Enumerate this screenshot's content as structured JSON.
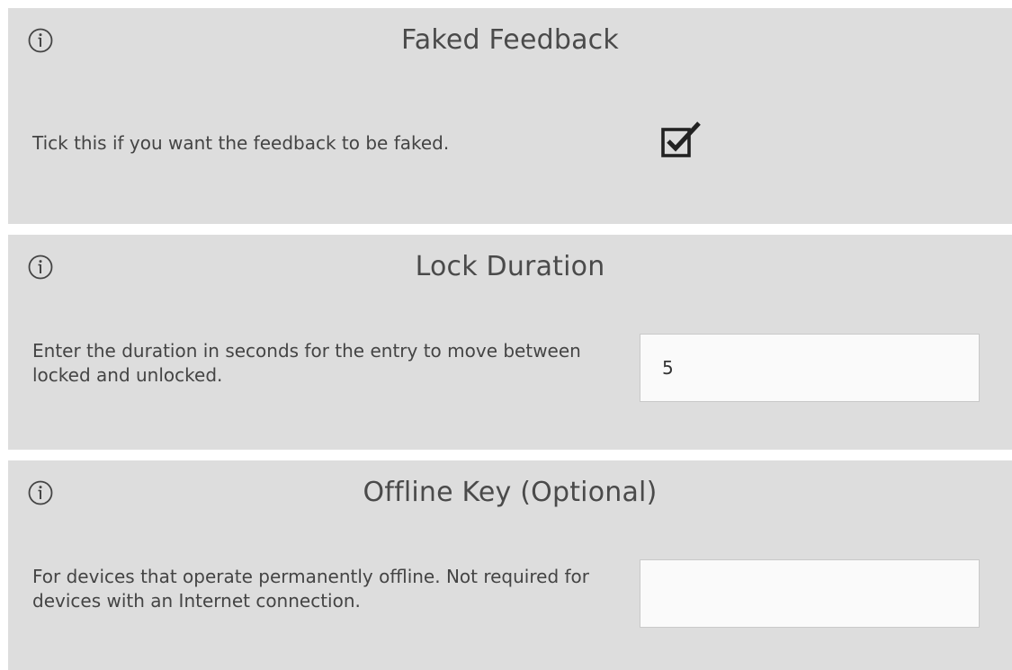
{
  "settings": [
    {
      "title": "Faked Feedback",
      "description": "Tick this if you want the feedback to be faked.",
      "control": "checkbox",
      "checked": true
    },
    {
      "title": "Lock Duration",
      "description": "Enter the duration in seconds for the entry to move between locked and unlocked.",
      "control": "text-input",
      "value": "5",
      "placeholder": ""
    },
    {
      "title": "Offline Key (Optional)",
      "description": "For devices that operate permanently offline. Not required for devices with an Internet connection.",
      "control": "text-input",
      "value": "",
      "placeholder": ""
    }
  ],
  "icons": {
    "info": "info-icon",
    "checkbox": "checkbox-checked-icon"
  },
  "colors": {
    "panel_background": "#dddddd",
    "text": "#444444",
    "input_background": "#fafafa",
    "input_border": "#c9c9c9"
  }
}
